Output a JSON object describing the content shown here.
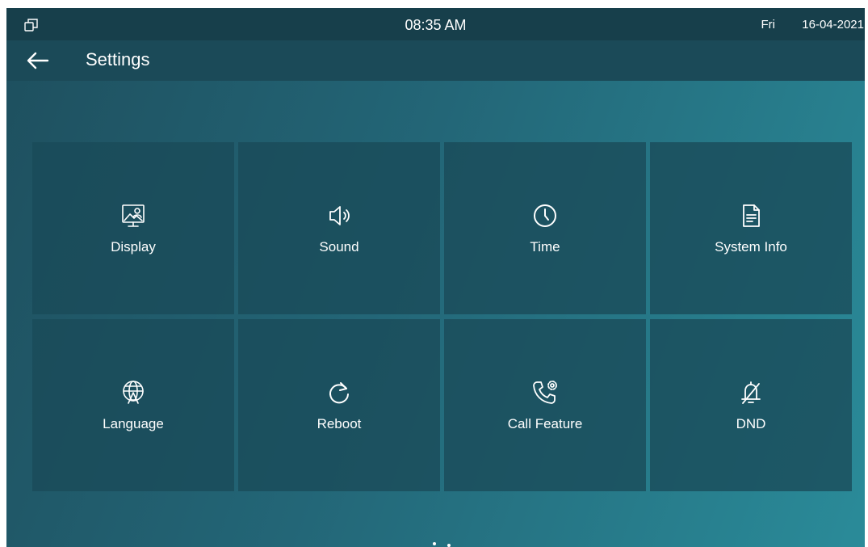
{
  "status_bar": {
    "time": "08:35 AM",
    "day": "Fri",
    "date": "16-04-2021",
    "left_icon": "window-restore-icon"
  },
  "header": {
    "title": "Settings",
    "back_icon": "back-arrow-icon"
  },
  "tiles": [
    {
      "label": "Display",
      "icon": "display-icon"
    },
    {
      "label": "Sound",
      "icon": "speaker-icon"
    },
    {
      "label": "Time",
      "icon": "clock-icon"
    },
    {
      "label": "System Info",
      "icon": "document-icon"
    },
    {
      "label": "Language",
      "icon": "globe-icon"
    },
    {
      "label": "Reboot",
      "icon": "reboot-icon"
    },
    {
      "label": "Call Feature",
      "icon": "phone-gear-icon"
    },
    {
      "label": "DND",
      "icon": "bell-off-icon"
    }
  ],
  "pagination": {
    "pages": 2,
    "current": 2
  },
  "colors": {
    "status_bar": "#173f4b",
    "title_bar": "#1b4a58",
    "tile": "#1a4a58",
    "gradient_start": "#1e4f5e",
    "gradient_end": "#2a8b99",
    "text": "#ffffff"
  }
}
